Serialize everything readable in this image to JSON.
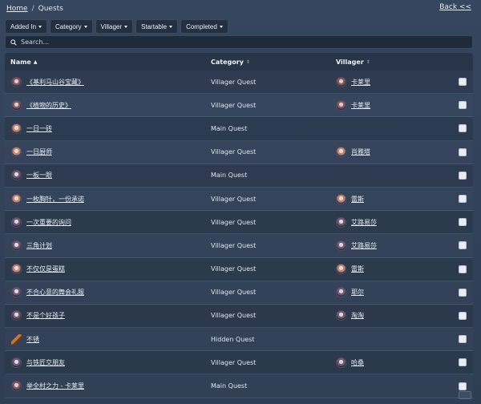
{
  "breadcrumb": {
    "home": "Home",
    "separator": "/",
    "current": "Quests"
  },
  "back_label": "Back <<",
  "filters": [
    "Added In",
    "Category",
    "Villager",
    "Startable",
    "Completed"
  ],
  "search": {
    "placeholder": "Search..."
  },
  "columns": {
    "name": "Name",
    "category": "Category",
    "villager": "Villager"
  },
  "rows": [
    {
      "name": "《基利马山谷宝藏》",
      "category": "Villager Quest",
      "villager": "卡莱里",
      "avatar": "v1",
      "villager_avatar": "v1"
    },
    {
      "name": "《植物的历史》",
      "category": "Villager Quest",
      "villager": "卡莱里",
      "avatar": "v1",
      "villager_avatar": "v1"
    },
    {
      "name": "一日一砖",
      "category": "Main Quest",
      "villager": "",
      "avatar": "v2",
      "villager_avatar": ""
    },
    {
      "name": "一日厨师",
      "category": "Villager Quest",
      "villager": "肖雅塔",
      "avatar": "v2",
      "villager_avatar": "v2"
    },
    {
      "name": "一板一眼",
      "category": "Main Quest",
      "villager": "",
      "avatar": "v3",
      "villager_avatar": ""
    },
    {
      "name": "一枚胸针，一份承诺",
      "category": "Villager Quest",
      "villager": "雷斯",
      "avatar": "v2",
      "villager_avatar": "v2"
    },
    {
      "name": "一次重要的询问",
      "category": "Villager Quest",
      "villager": "艾路易莎",
      "avatar": "v3",
      "villager_avatar": "v3"
    },
    {
      "name": "三角计划",
      "category": "Villager Quest",
      "villager": "艾路易莎",
      "avatar": "v3",
      "villager_avatar": "v3"
    },
    {
      "name": "不仅仅是蛋糕",
      "category": "Villager Quest",
      "villager": "雷斯",
      "avatar": "v2",
      "villager_avatar": "v2"
    },
    {
      "name": "不合心意的舞会礼服",
      "category": "Villager Quest",
      "villager": "耶尔",
      "avatar": "v3",
      "villager_avatar": "v3"
    },
    {
      "name": "不是个好孩子",
      "category": "Villager Quest",
      "villager": "淘淘",
      "avatar": "v3",
      "villager_avatar": "v3"
    },
    {
      "name": "不锈",
      "category": "Hidden Quest",
      "villager": "",
      "avatar": "item",
      "villager_avatar": ""
    },
    {
      "name": "与铁匠交朋友",
      "category": "Villager Quest",
      "villager": "哈桑",
      "avatar": "v3",
      "villager_avatar": "v3"
    },
    {
      "name": "举全村之力 - 卡莱里",
      "category": "Main Quest",
      "villager": "",
      "avatar": "v1",
      "villager_avatar": ""
    }
  ]
}
